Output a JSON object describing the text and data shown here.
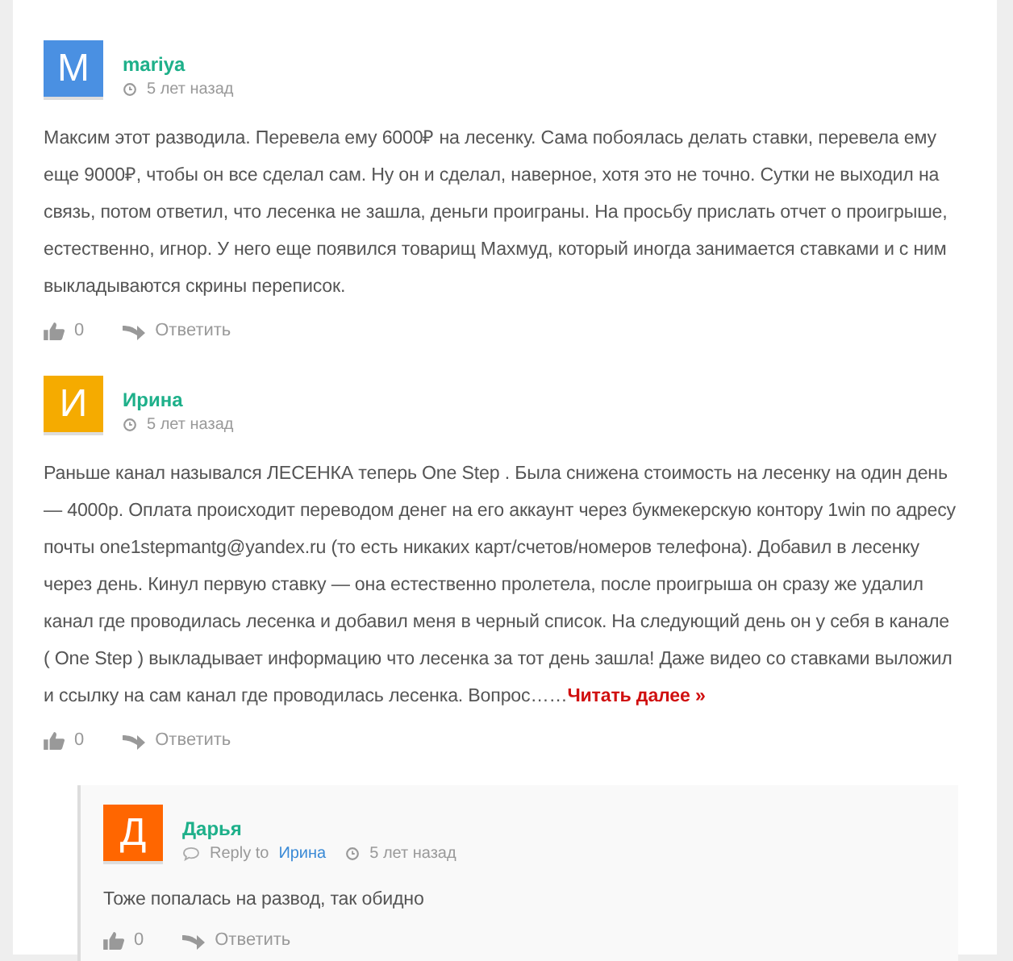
{
  "comments": [
    {
      "initial": "М",
      "color": "#4a90e2",
      "author": "mariya",
      "time": "5 лет назад",
      "text": "Максим этот разводила. Перевела ему 6000₽ на лесенку. Сама побоялась делать ставки, перевела ему еще 9000₽, чтобы он все сделал сам. Ну он и сделал, наверное, хотя это не точно. Сутки не выходил на связь, потом ответил, что лесенка не зашла, деньги проиграны. На просьбу прислать отчет о проигрыше, естественно, игнор. У него еще появился товарищ Махмуд, который иногда занимается ставками и с ним выкладываются скрины переписок.",
      "likes": "0",
      "reply": "Ответить"
    },
    {
      "initial": "И",
      "color": "#f5ab00",
      "author": "Ирина",
      "time": "5 лет назад",
      "text": "Раньше канал назывался ЛЕСЕНКА теперь One Step . Была снижена стоимость на лесенку на один день — 4000р. Оплата происходит переводом денег на его аккаунт через букмекерскую контору 1win по адресу почты one1stepmantg@yandex.ru (то есть никаких карт/счетов/номеров телефона). Добавил в лесенку через день. Кинул первую ставку — она естественно пролетела, после проигрыша он сразу же удалил канал где проводилась лесенка и добавил меня в черный список. На следующий день он у себя в канале ( One Step ) выкладывает информацию что лесенка за тот день зашла! Даже видео со ставками выложил и ссылку на сам канал где проводилась лесенка. Вопрос……",
      "more": "Читать далее »",
      "likes": "0",
      "reply": "Ответить",
      "replies": [
        {
          "initial": "Д",
          "color": "#ff6600",
          "author": "Дарья",
          "reply_to_label": "Reply to",
          "reply_to": "Ирина",
          "time": "5 лет назад",
          "text": "Тоже попалась на развод, так обидно",
          "likes": "0",
          "reply": "Ответить"
        }
      ]
    }
  ]
}
